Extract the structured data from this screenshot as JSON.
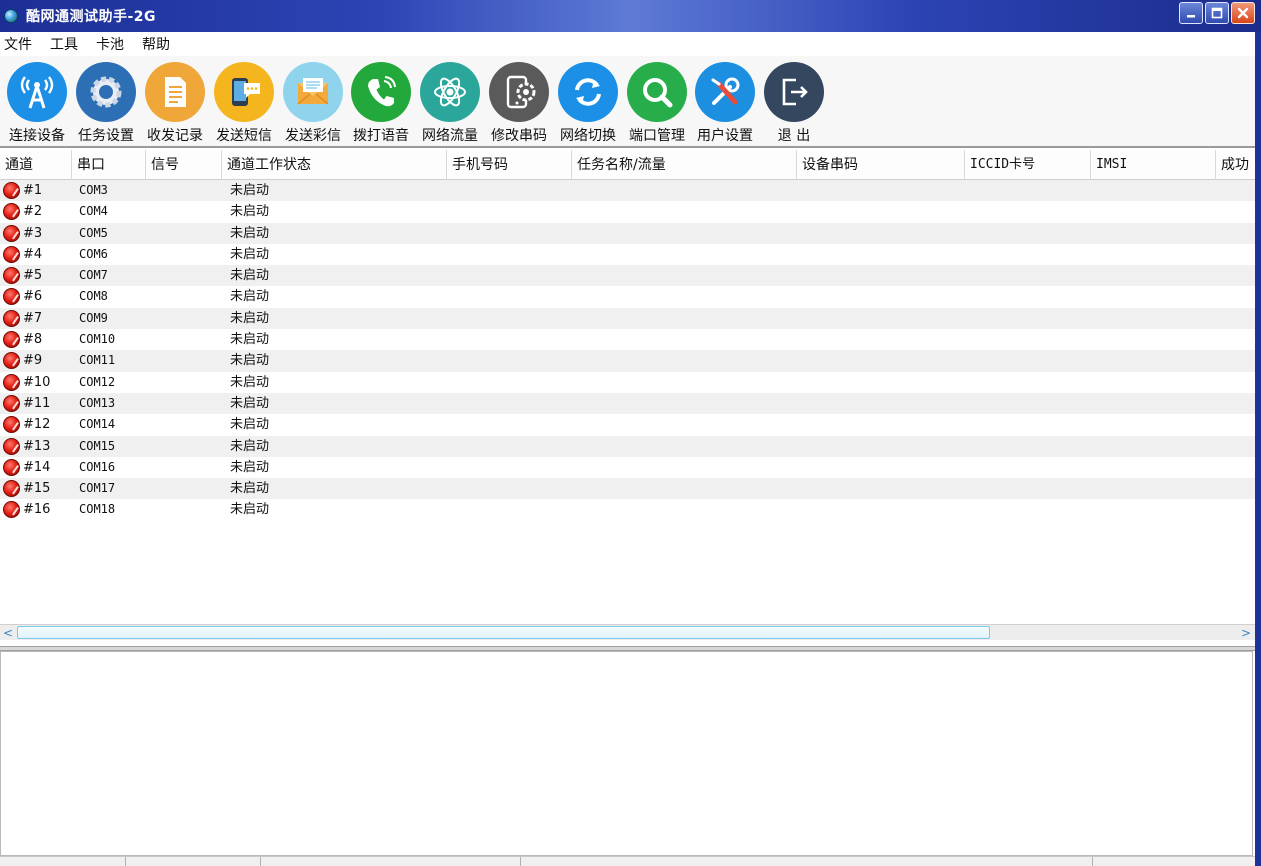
{
  "window": {
    "title": "酷网通测试助手-2G"
  },
  "menu": [
    "文件",
    "工具",
    "卡池",
    "帮助"
  ],
  "toolbar": [
    {
      "label": "连接设备",
      "icon": "signal-tower-icon",
      "color": "#1c8fe6"
    },
    {
      "label": "任务设置",
      "icon": "gear-icon",
      "color": "#2d6fb5"
    },
    {
      "label": "收发记录",
      "icon": "document-icon",
      "color": "#f0a73a"
    },
    {
      "label": "发送短信",
      "icon": "phone-chat-icon",
      "color": "#f5b51f"
    },
    {
      "label": "发送彩信",
      "icon": "envelope-icon",
      "color": "#8fd3ec"
    },
    {
      "label": "拨打语音",
      "icon": "phone-call-icon",
      "color": "#23a83c"
    },
    {
      "label": "网络流量",
      "icon": "atom-icon",
      "color": "#2aa79a"
    },
    {
      "label": "修改串码",
      "icon": "phone-gear-icon",
      "color": "#5a5a5a"
    },
    {
      "label": "网络切换",
      "icon": "refresh-icon",
      "color": "#1c8fe6"
    },
    {
      "label": "端口管理",
      "icon": "magnifier-icon",
      "color": "#27ae4a"
    },
    {
      "label": "用户设置",
      "icon": "tools-icon",
      "color": "#1d8fe0"
    },
    {
      "label": "退 出",
      "icon": "exit-icon",
      "color": "#34475f"
    }
  ],
  "table": {
    "columns": [
      "通道",
      "串口",
      "信号",
      "通道工作状态",
      "手机号码",
      "任务名称/流量",
      "设备串码",
      "ICCID卡号",
      "IMSI",
      "成功"
    ],
    "rows": [
      {
        "channel": "#1",
        "port": "COM3",
        "status": "未启动"
      },
      {
        "channel": "#2",
        "port": "COM4",
        "status": "未启动"
      },
      {
        "channel": "#3",
        "port": "COM5",
        "status": "未启动"
      },
      {
        "channel": "#4",
        "port": "COM6",
        "status": "未启动"
      },
      {
        "channel": "#5",
        "port": "COM7",
        "status": "未启动"
      },
      {
        "channel": "#6",
        "port": "COM8",
        "status": "未启动"
      },
      {
        "channel": "#7",
        "port": "COM9",
        "status": "未启动"
      },
      {
        "channel": "#8",
        "port": "COM10",
        "status": "未启动"
      },
      {
        "channel": "#9",
        "port": "COM11",
        "status": "未启动"
      },
      {
        "channel": "#10",
        "port": "COM12",
        "status": "未启动"
      },
      {
        "channel": "#11",
        "port": "COM13",
        "status": "未启动"
      },
      {
        "channel": "#12",
        "port": "COM14",
        "status": "未启动"
      },
      {
        "channel": "#13",
        "port": "COM15",
        "status": "未启动"
      },
      {
        "channel": "#14",
        "port": "COM16",
        "status": "未启动"
      },
      {
        "channel": "#15",
        "port": "COM17",
        "status": "未启动"
      },
      {
        "channel": "#16",
        "port": "COM18",
        "status": "未启动"
      }
    ]
  },
  "scrollbar": {
    "left_arrow": "<",
    "right_arrow": ">"
  }
}
